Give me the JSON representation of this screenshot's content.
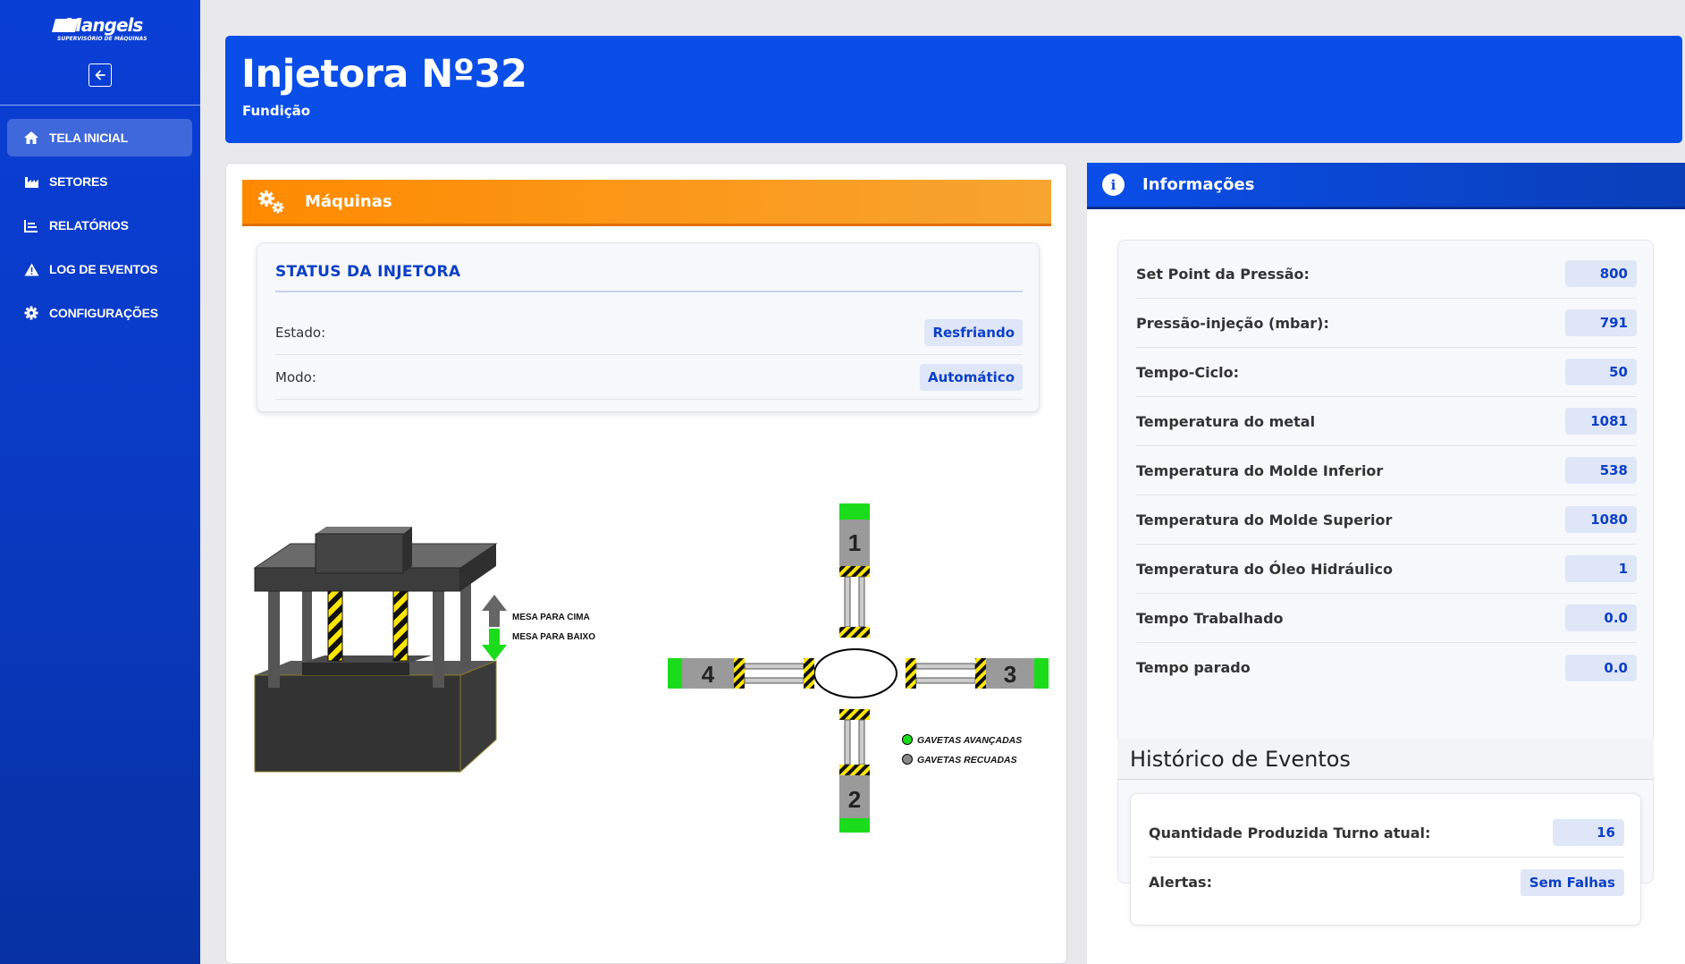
{
  "sidebar": {
    "logo": {
      "name": "Mangels",
      "tagline": "SUPERVISÓRIO DE MÁQUINAS"
    },
    "collapse_icon": "arrow-left-icon",
    "items": [
      {
        "label": "TELA INICIAL",
        "icon": "home-icon",
        "active": true
      },
      {
        "label": "SETORES",
        "icon": "factory-icon",
        "active": false
      },
      {
        "label": "RELATÓRIOS",
        "icon": "chart-icon",
        "active": false
      },
      {
        "label": "LOG DE EVENTOS",
        "icon": "warning-icon",
        "active": false
      },
      {
        "label": "CONFIGURAÇÕES",
        "icon": "gear-icon",
        "active": false
      }
    ]
  },
  "header": {
    "title": "Injetora Nº32",
    "subtitle": "Fundição"
  },
  "machines": {
    "label": "Máquinas",
    "icon": "gears-icon",
    "status": {
      "title": "STATUS DA INJETORA",
      "rows": [
        {
          "label": "Estado:",
          "value": "Resfriando"
        },
        {
          "label": "Modo:",
          "value": "Automático"
        }
      ]
    },
    "press_legend": {
      "up": "MESA PARA CIMA",
      "down": "MESA PARA BAIXO"
    },
    "drawers": {
      "labels": [
        "1",
        "2",
        "3",
        "4"
      ],
      "legend_advanced": "GAVETAS AVANÇADAS",
      "legend_retracted": "GAVETAS RECUADAS"
    }
  },
  "info": {
    "label": "Informações",
    "icon": "info-icon",
    "rows": [
      {
        "label": "Set Point da Pressão:",
        "value": "800"
      },
      {
        "label": "Pressão-injeção (mbar):",
        "value": "791"
      },
      {
        "label": "Tempo-Ciclo:",
        "value": "50"
      },
      {
        "label": "Temperatura do metal",
        "value": "1081"
      },
      {
        "label": "Temperatura do Molde Inferior",
        "value": "538"
      },
      {
        "label": "Temperatura do Molde Superior",
        "value": "1080"
      },
      {
        "label": "Temperatura do Óleo Hidráulico",
        "value": "1"
      },
      {
        "label": "Tempo Trabalhado",
        "value": "0.0"
      },
      {
        "label": "Tempo parado",
        "value": "0.0"
      }
    ]
  },
  "history": {
    "title": "Histórico de Eventos",
    "rows": [
      {
        "label": "Quantidade Produzida Turno atual:",
        "value": "16"
      },
      {
        "label": "Alertas:",
        "value": "Sem Falhas"
      }
    ]
  },
  "colors": {
    "primary": "#0a4ee8",
    "accent_orange": "#ff8a00",
    "drawer_green": "#1bdc1b",
    "hazard_yellow": "#ffe600"
  }
}
